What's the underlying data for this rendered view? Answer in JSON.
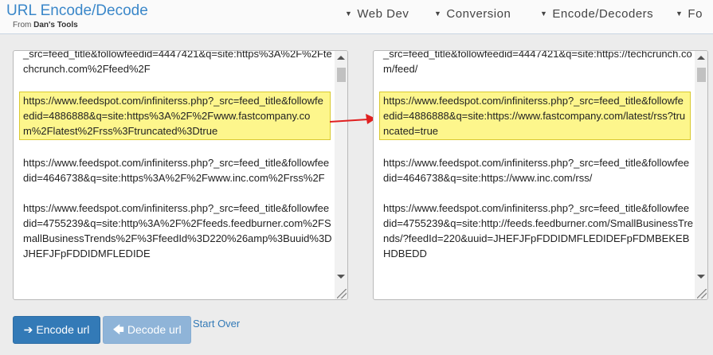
{
  "header": {
    "title": "URL Encode/Decode",
    "subtitle_prefix": "From",
    "subtitle_brand": "Dan's Tools",
    "nav": [
      {
        "label": "Web Dev"
      },
      {
        "label": "Conversion"
      },
      {
        "label": "Encode/Decoders"
      },
      {
        "label": "Fo"
      }
    ]
  },
  "left_panel": {
    "entries": [
      "_src=feed_title&followfeedid=4447421&q=site:https%3A%2F%2Ftechcrunch.com%2Ffeed%2F",
      "https://www.feedspot.com/infiniterss.php?_src=feed_title&followfeedid=4886888&q=site:https%3A%2F%2Fwww.fastcompany.com%2Flatest%2Frss%3Ftruncated%3Dtrue",
      "https://www.feedspot.com/infiniterss.php?_src=feed_title&followfeedid=4646738&q=site:https%3A%2F%2Fwww.inc.com%2Frss%2F",
      "https://www.feedspot.com/infiniterss.php?_src=feed_title&followfeedid=4755239&q=site:http%3A%2F%2Ffeeds.feedburner.com%2FSmallBusinessTrends%2F%3FfeedId%3D220%26amp%3Buuid%3DJHEFJFpFDDIDMFLEDIDE"
    ]
  },
  "right_panel": {
    "entries": [
      "_src=feed_title&followfeedid=4447421&q=site:https://techcrunch.com/feed/",
      "https://www.feedspot.com/infiniterss.php?_src=feed_title&followfeedid=4886888&q=site:https://www.fastcompany.com/latest/rss?truncated=true",
      "https://www.feedspot.com/infiniterss.php?_src=feed_title&followfeedid=4646738&q=site:https://www.inc.com/rss/",
      "https://www.feedspot.com/infiniterss.php?_src=feed_title&followfeedid=4755239&q=site:http://feeds.feedburner.com/SmallBusinessTrends/?feedId=220&uuid=JHEFJFpFDDIDMFLEDIDEFpFDMBEKEBHDBEDD"
    ]
  },
  "actions": {
    "encode_label": "Encode url",
    "decode_label": "Decode url",
    "start_over_label": "Start Over"
  },
  "icons": {
    "encode": "arrow-right-icon",
    "decode": "arrow-left-icon",
    "nav_caret": "caret-down-icon"
  },
  "colors": {
    "accent": "#337ab7",
    "title": "#3a87c9",
    "highlight": "#fdf68c",
    "arrow": "#e02020"
  }
}
